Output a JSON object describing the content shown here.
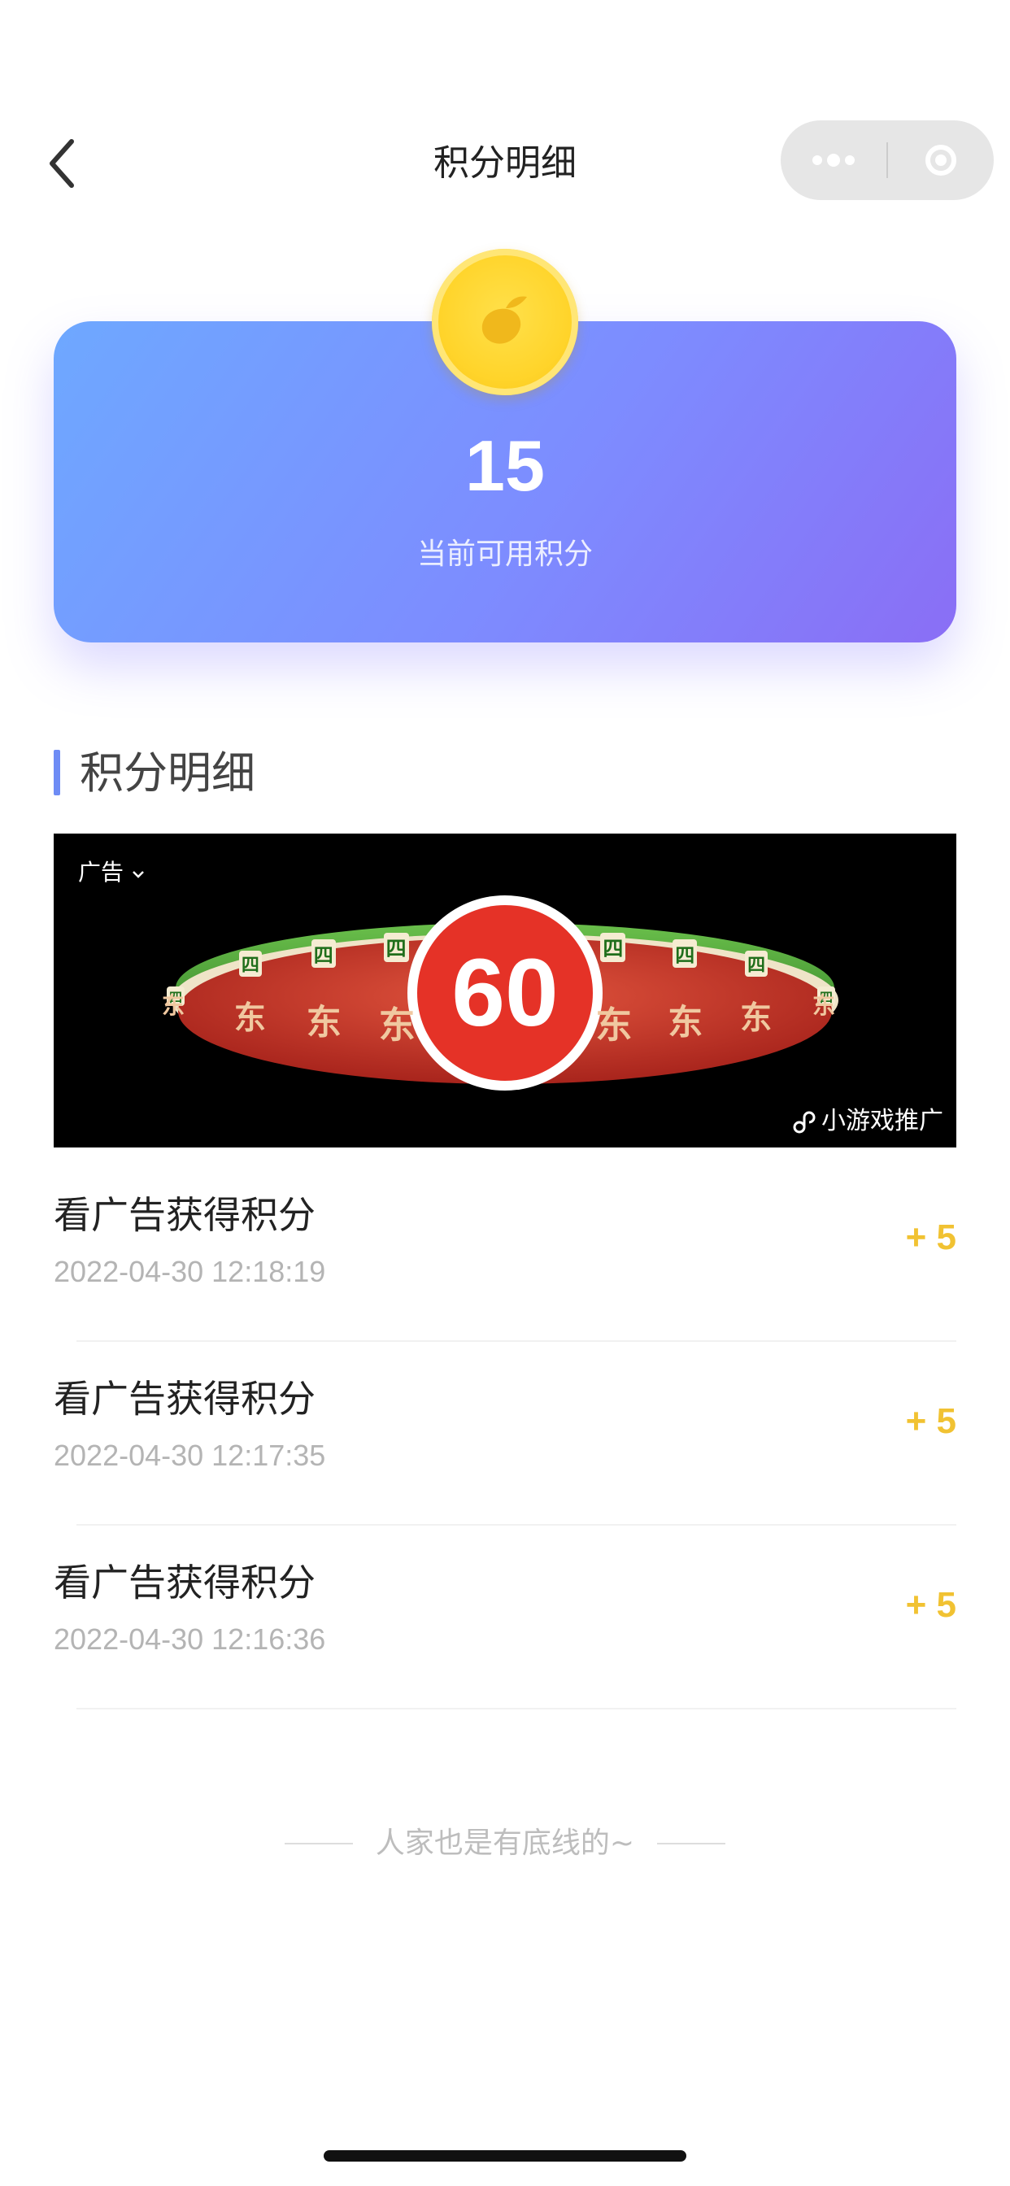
{
  "nav": {
    "title": "积分明细",
    "back_icon": "chevron-left-icon",
    "more_icon": "more-dots-icon",
    "close_icon": "target-circle-icon"
  },
  "points_card": {
    "value": "15",
    "label": "当前可用积分",
    "coin_icon": "mango-coin-icon",
    "gradient_start": "#6ea8ff",
    "gradient_end": "#8a6ef5"
  },
  "section": {
    "title": "积分明细",
    "accent_color": "#6e8cf5"
  },
  "ad": {
    "tag": "广告",
    "source": "小游戏推广",
    "badge_number": "60",
    "tiles_top": [
      "四",
      "四",
      "四",
      "四",
      "四",
      "四",
      "四",
      "四",
      "四",
      "四"
    ],
    "tiles_bottom": [
      "东",
      "东",
      "东",
      "东",
      "东",
      "东",
      "东",
      "东",
      "东",
      "东"
    ]
  },
  "records": [
    {
      "title": "看广告获得积分",
      "time": "2022-04-30 12:18:19",
      "points": "+ 5"
    },
    {
      "title": "看广告获得积分",
      "time": "2022-04-30 12:17:35",
      "points": "+ 5"
    },
    {
      "title": "看广告获得积分",
      "time": "2022-04-30 12:16:36",
      "points": "+ 5"
    }
  ],
  "footer": {
    "end_text": "人家也是有底线的~"
  },
  "colors": {
    "points_positive": "#f1c232",
    "time_text": "#b4b4b4"
  }
}
